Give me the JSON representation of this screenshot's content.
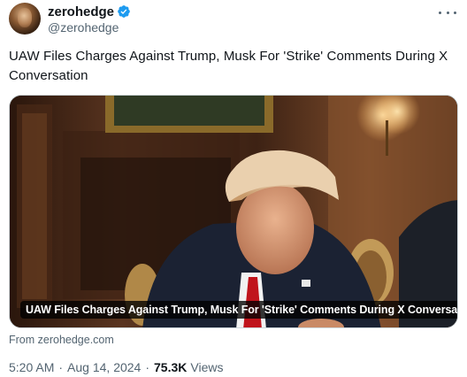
{
  "author": {
    "display_name": "zerohedge",
    "handle": "@zerohedge",
    "verified": true,
    "verified_color": "#1d9bf0"
  },
  "more_icon": "more-horizontal-icon",
  "tweet": {
    "text": "UAW Files Charges Against Trump, Musk For 'Strike' Comments During X Conversation"
  },
  "card": {
    "caption": "UAW Files Charges Against Trump, Musk For 'Strike' Comments During X Conversation",
    "source": "From zerohedge.com"
  },
  "meta": {
    "time": "5:20 AM",
    "date": "Aug 14, 2024",
    "separator": "·",
    "views_count": "75.3K",
    "views_label": "Views"
  }
}
